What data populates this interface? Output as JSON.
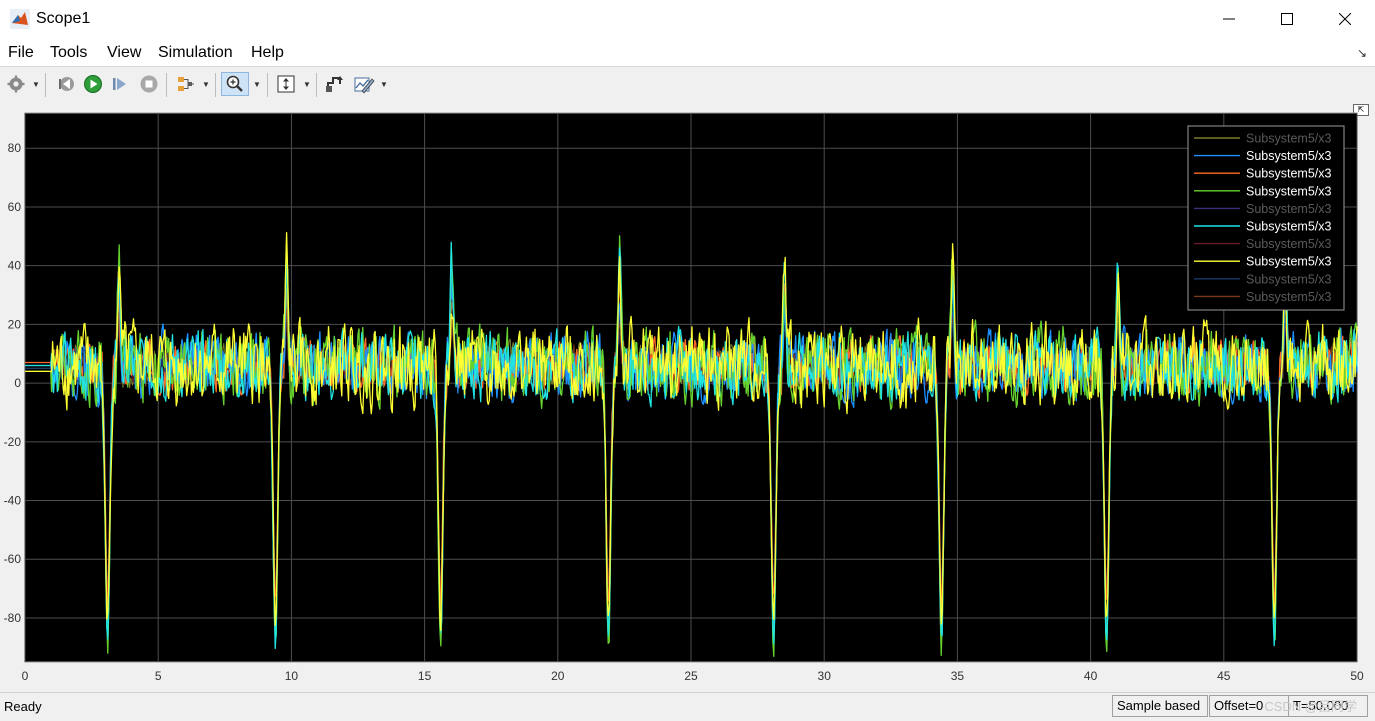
{
  "window": {
    "title": "Scope1"
  },
  "menu": {
    "file": "File",
    "tools": "Tools",
    "view": "View",
    "simulation": "Simulation",
    "help": "Help"
  },
  "toolbar": {
    "icons": [
      "gear-icon",
      "step-back-icon",
      "run-icon",
      "step-forward-icon",
      "stop-icon",
      "signal-selector-icon",
      "zoom-icon",
      "autoscale-icon",
      "highlight-block-icon",
      "measurements-icon"
    ]
  },
  "status": {
    "ready": "Ready",
    "sample": "Sample based",
    "offset": "Offset=0",
    "time": "T=50.000"
  },
  "watermark": "CSDN @吕同学",
  "colors": {
    "plot_bg": "#000000",
    "grid": "#4d4d4d",
    "axis_text": "#d0d0d0"
  },
  "chart_data": {
    "type": "line",
    "xlim": [
      0,
      50
    ],
    "ylim": [
      -95,
      92
    ],
    "x_ticks": [
      0,
      5,
      10,
      15,
      20,
      25,
      30,
      35,
      40,
      45,
      50
    ],
    "y_ticks": [
      -80,
      -60,
      -40,
      -20,
      0,
      20,
      40,
      60,
      80
    ],
    "grid": true,
    "legend_placement": "top-right",
    "dip_times": [
      3.1,
      9.4,
      15.6,
      21.9,
      28.1,
      34.4,
      40.6,
      46.9
    ],
    "series": [
      {
        "name": "Subsystem5/x3",
        "color": "#7a7a2a",
        "dim": true,
        "seed": 1,
        "noise": 6,
        "dip": -80,
        "spike": 30
      },
      {
        "name": "Subsystem5/x3",
        "color": "#1e90ff",
        "dim": false,
        "seed": 2,
        "noise": 9,
        "dip": -86,
        "spike": 38
      },
      {
        "name": "Subsystem5/x3",
        "color": "#ff6a2a",
        "dim": false,
        "seed": 3,
        "noise": 7,
        "dip": -75,
        "spike": 36
      },
      {
        "name": "Subsystem5/x3",
        "color": "#66d22e",
        "dim": false,
        "seed": 4,
        "noise": 10,
        "dip": -90,
        "spike": 48
      },
      {
        "name": "Subsystem5/x3",
        "color": "#3b2f7a",
        "dim": true,
        "seed": 5,
        "noise": 5,
        "dip": -70,
        "spike": 25
      },
      {
        "name": "Subsystem5/x3",
        "color": "#20e4e4",
        "dim": false,
        "seed": 6,
        "noise": 9,
        "dip": -88,
        "spike": 42
      },
      {
        "name": "Subsystem5/x3",
        "color": "#6a1a2a",
        "dim": true,
        "seed": 7,
        "noise": 5,
        "dip": -70,
        "spike": 25
      },
      {
        "name": "Subsystem5/x3",
        "color": "#ffff33",
        "dim": false,
        "seed": 8,
        "noise": 11,
        "dip": -82,
        "spike": 44
      },
      {
        "name": "Subsystem5/x3",
        "color": "#1a3a6a",
        "dim": true,
        "seed": 9,
        "noise": 5,
        "dip": -70,
        "spike": 25
      },
      {
        "name": "Subsystem5/x3",
        "color": "#7a3a1a",
        "dim": true,
        "seed": 10,
        "noise": 5,
        "dip": -70,
        "spike": 25
      }
    ]
  }
}
